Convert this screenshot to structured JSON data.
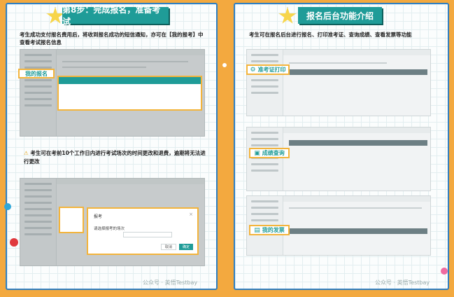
{
  "left": {
    "title": "第8步：完成报名，准备考试",
    "description": "考生成功支付报名费用后，将收到报名成功的短信通知，亦可在【我的报考】中查看考试报名信息",
    "callout_label": "我的报名",
    "warning": "考生可在考前10个工作日内进行考试场次的时间更改和退费，逾期将无法进行更改",
    "modal": {
      "title": "报考",
      "label": "请选择报考的场次",
      "cancel": "取消",
      "ok": "确定"
    }
  },
  "right": {
    "title": "报名后台功能介绍",
    "description": "考生可在报名后台进行报名、打印准考证、查询成绩、查看发票等功能",
    "features": [
      {
        "label": "准考证打印",
        "icon": "gear-icon"
      },
      {
        "label": "成绩查询",
        "icon": "document-icon"
      },
      {
        "label": "我的发票",
        "icon": "invoice-icon"
      }
    ]
  },
  "watermarks": [
    "公众号 · 英悟Testbay",
    "公众号 · 英悟Testbay"
  ],
  "colors": {
    "accent": "#1f9c98",
    "highlight": "#f3b43c",
    "frame": "#2f7fc2",
    "background": "#f3a93f"
  }
}
